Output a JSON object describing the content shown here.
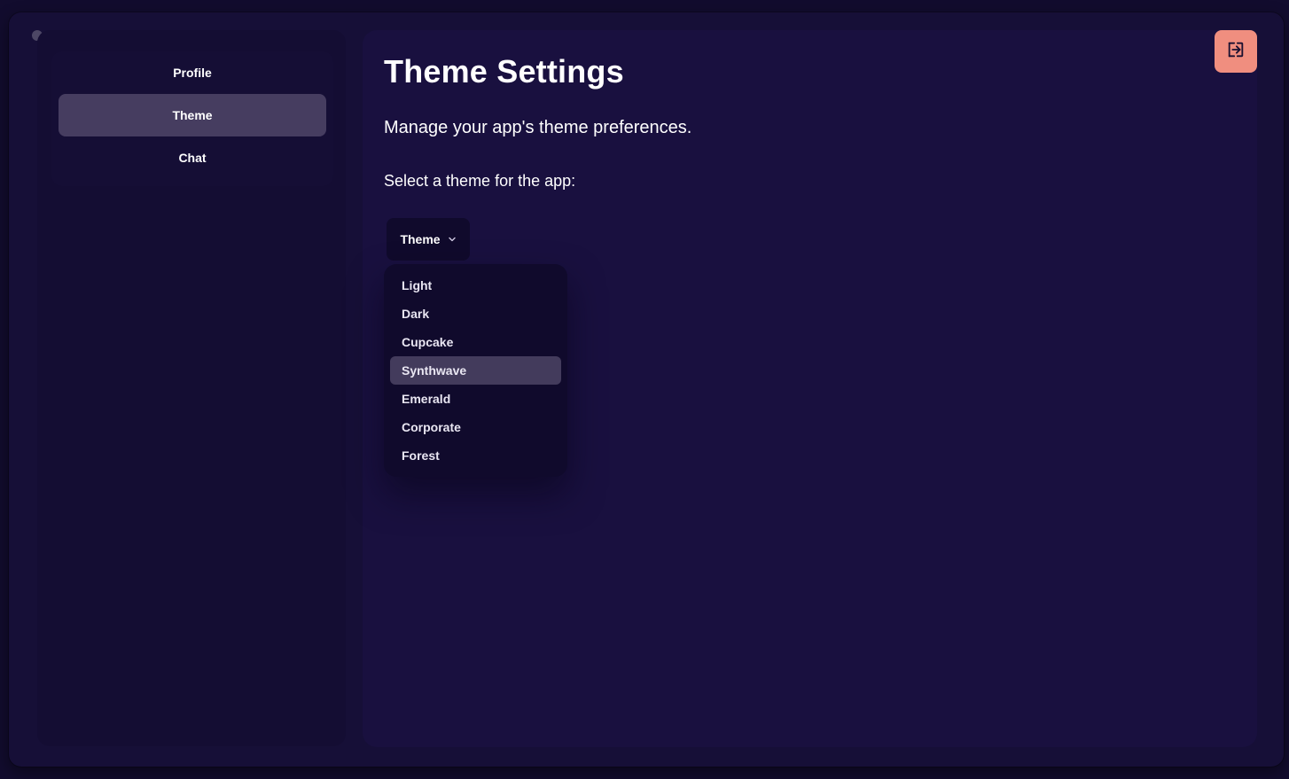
{
  "sidebar": {
    "items": [
      {
        "label": "Profile",
        "active": false
      },
      {
        "label": "Theme",
        "active": true
      },
      {
        "label": "Chat",
        "active": false
      }
    ]
  },
  "main": {
    "title": "Theme Settings",
    "description": "Manage your app's theme preferences.",
    "select_label": "Select a theme for the app:",
    "dropdown": {
      "label": "Theme",
      "options": [
        "Light",
        "Dark",
        "Cupcake",
        "Synthwave",
        "Emerald",
        "Corporate",
        "Forest"
      ],
      "highlighted": "Synthwave"
    },
    "logout_icon": "logout-icon"
  },
  "colors": {
    "background": "#160f37",
    "panel": "#19103f",
    "active_item": "#463d60",
    "logout_button": "#f08e7f"
  }
}
